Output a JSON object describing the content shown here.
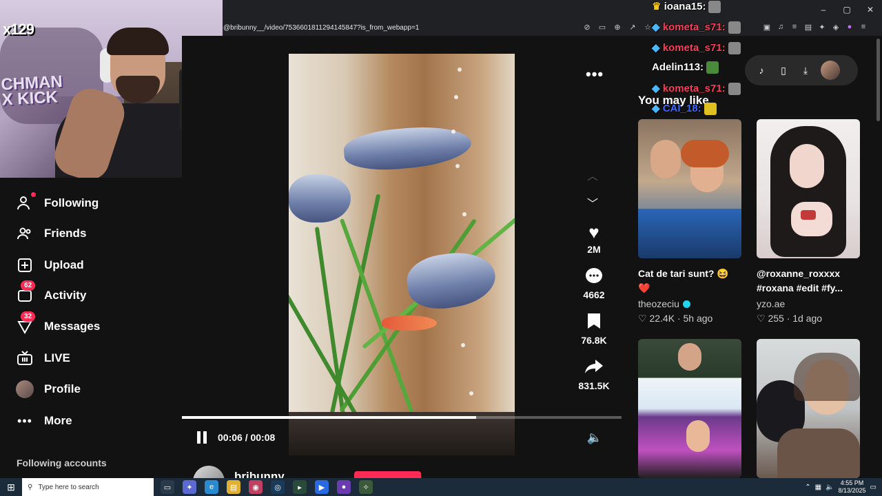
{
  "browser": {
    "url": "@bribunny__/video/7536601811294145847?is_from_webapp=1",
    "window_controls": [
      "–",
      "▢",
      "✕"
    ]
  },
  "webcam": {
    "logo_text": "x129",
    "overlay_text": "CHMAN X KICK"
  },
  "sidebar": {
    "items": [
      {
        "label": "Following",
        "icon": "following-icon"
      },
      {
        "label": "Friends",
        "icon": "friends-icon"
      },
      {
        "label": "Upload",
        "icon": "upload-icon"
      },
      {
        "label": "Activity",
        "icon": "activity-icon",
        "badge": "62"
      },
      {
        "label": "Messages",
        "icon": "messages-icon",
        "badge": "32"
      },
      {
        "label": "LIVE",
        "icon": "live-icon"
      },
      {
        "label": "Profile",
        "icon": "profile-avatar"
      },
      {
        "label": "More",
        "icon": "more-icon"
      }
    ],
    "following_accounts": "Following accounts"
  },
  "video": {
    "time_current": "00:06",
    "time_total": "00:08",
    "time_display": "00:06 / 00:08",
    "progress": 0.67,
    "author": "bribunny"
  },
  "actions": {
    "likes": "2M",
    "comments": "4662",
    "saves": "76.8K",
    "shares": "831.5K"
  },
  "right_panel": {
    "title": "You may like",
    "cards": [
      {
        "title": "Cat de tari sunt? 😆 ❤️",
        "author": "theozeciu",
        "verified": true,
        "likes": "22.4K",
        "time": "5h ago"
      },
      {
        "title": "@roxanne_roxxxx #roxana #edit #fy...",
        "author": "yzo.ae",
        "verified": false,
        "likes": "255",
        "time": "1d ago"
      }
    ]
  },
  "chat": [
    {
      "user": "ioana15:",
      "color": "#ffffff"
    },
    {
      "user": "kometa_s71:",
      "color": "#ff3b5c"
    },
    {
      "user": "kometa_s71:",
      "color": "#ff3b5c"
    },
    {
      "user": "Adelin113:",
      "color": "#ffffff"
    },
    {
      "user": "kometa_s71:",
      "color": "#ff3b5c"
    },
    {
      "user": "CAI_18:",
      "color": "#3a6bff"
    }
  ],
  "taskbar": {
    "search_placeholder": "Type here to search",
    "time": "4:55 PM",
    "date": "8/13/2025"
  },
  "colors": {
    "accent": "#fe2c55",
    "background": "#121212",
    "verified": "#20d5ec"
  }
}
